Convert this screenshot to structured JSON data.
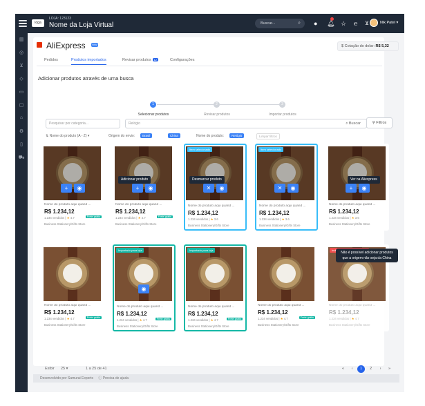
{
  "topbar": {
    "store_sub": "LOJA: 123123",
    "store_name": "Nome da Loja Virtual",
    "logo": "loga",
    "search": "Buscar...",
    "user": "Nik Patel ▾"
  },
  "aliexpress": {
    "name": "AliExpress",
    "tag": "WW",
    "rate_label": "Cotação do dolar:",
    "rate_value": "R$ 5,32"
  },
  "tabs": [
    {
      "label": "Pedidos"
    },
    {
      "label": "Produtos importados"
    },
    {
      "label": "Revisar produtos",
      "count": "12"
    },
    {
      "label": "Configurações"
    }
  ],
  "heading": "Adicionar produtos através de uma busca",
  "steps": [
    {
      "n": "1",
      "label": "Selecionar produtos"
    },
    {
      "n": "2",
      "label": "Revisar produtos"
    },
    {
      "n": "3",
      "label": "Importar produtos"
    }
  ],
  "filters": {
    "category": "Pesquisar por categoria...",
    "query": "Relógio",
    "search": "Buscar",
    "filter_button": "Filtros"
  },
  "chips": {
    "sort": "Nome do produto (A - Z) ▾",
    "origin_label": "Origem do envio:",
    "origin_1": "Brasil",
    "origin_2": "China",
    "name_label": "Nome do produto:",
    "name_value": "Relógio",
    "clear": "Limpar filtros"
  },
  "cards": [
    {
      "name": "Nome do produto aqui quand ...",
      "price": "R$ 1.234,12",
      "sold": "1.234 vendidos",
      "rating": "4.7",
      "free": "Frete grátis",
      "seller": "Business Stationery/Gifts Store",
      "flag": "",
      "tooltip": ""
    },
    {
      "name": "Nome do produto aqui quand ...",
      "price": "R$ 1.234,12",
      "sold": "1.234 vendidos",
      "rating": "4.7",
      "free": "Frete grátis",
      "seller": "Business Stationery/Gifts Store",
      "flag": "",
      "tooltip": "Adicionar produto"
    },
    {
      "name": "Nome do produto aqui quand ...",
      "price": "R$ 1.234,12",
      "sold": "1.234 vendidos",
      "rating": "3.6",
      "free": "",
      "seller": "Business Stationery/Gifts Store",
      "flag": "Item selecionado",
      "tooltip": "Desmarcar produto"
    },
    {
      "name": "Nome do produto aqui quand ...",
      "price": "R$ 1.234,12",
      "sold": "1.234 vendidos",
      "rating": "3.6",
      "free": "",
      "seller": "Business Stationery/Gifts Store",
      "flag": "Item selecionado",
      "tooltip": ""
    },
    {
      "name": "Nome do produto aqui quand ...",
      "price": "R$ 1.234,12",
      "sold": "1.234 vendidos",
      "rating": "3.6",
      "free": "",
      "seller": "Business Stationery/Gifts Store",
      "flag": "",
      "tooltip": "Ver na Aliexpress"
    },
    {
      "name": "Nome do produto aqui quand ...",
      "price": "R$ 1.234,12",
      "sold": "1.234 vendidos",
      "rating": "4.7",
      "free": "Frete grátis",
      "seller": "Business Stationery/Gifts Store",
      "flag": "",
      "tooltip": ""
    },
    {
      "name": "Nome do produto aqui quand ...",
      "price": "R$ 1.234,12",
      "sold": "1.234 vendidos",
      "rating": "4.7",
      "free": "Frete grátis",
      "seller": "Business Stationery/Gifts Store",
      "flag": "Importado para loja",
      "tooltip": ""
    },
    {
      "name": "Nome do produto aqui quand ...",
      "price": "R$ 1.234,12",
      "sold": "1.234 vendidos",
      "rating": "4.7",
      "free": "Frete grátis",
      "seller": "Business Stationery/Gifts Store",
      "flag": "Importado para loja",
      "tooltip": ""
    },
    {
      "name": "Nome do produto aqui quand ...",
      "price": "R$ 1.234,12",
      "sold": "1.234 vendidos",
      "rating": "4.7",
      "free": "Frete grátis",
      "seller": "Business Stationery/Gifts Store",
      "flag": "",
      "tooltip": ""
    },
    {
      "name": "Nome do produto aqui quand ...",
      "price": "R$ 1.234,12",
      "sold": "1.234 vendidos",
      "rating": "4.7",
      "free": "",
      "seller": "Business Stationery/Gifts Store",
      "flag": "Indisponível para importação",
      "tooltip": ""
    }
  ],
  "blocked_tooltip": "Não é possível adicionar produtos que a origem não seja da China",
  "pagination": {
    "show": "Exibir",
    "per_page": "25 ▾",
    "range": "1 a 25 de 41",
    "p1": "1",
    "p2": "2"
  },
  "footer": {
    "dev": "Desenvolvido por Samurai Experts",
    "help": "Precisa de ajuda"
  }
}
